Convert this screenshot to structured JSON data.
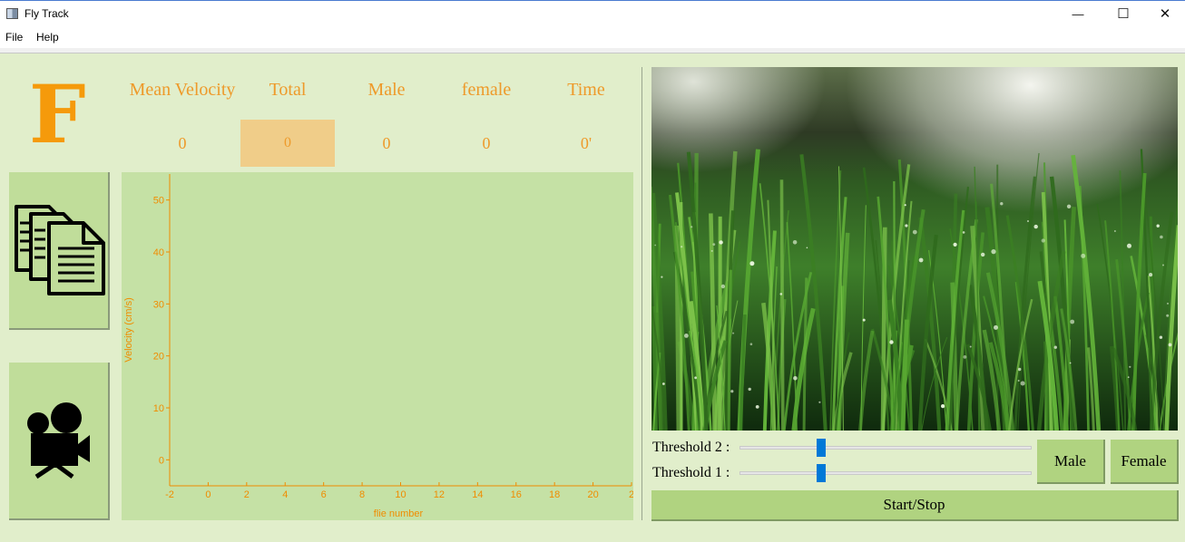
{
  "window": {
    "title": "Fly Track",
    "minimize": "—",
    "maximize": "☐",
    "close": "✕"
  },
  "menu": {
    "file": "File",
    "help": "Help"
  },
  "logo": {
    "letter": "F"
  },
  "stats": {
    "labels": {
      "mean_velocity": "Mean Velocity",
      "total": "Total",
      "male": "Male",
      "female": "female",
      "time": "Time"
    },
    "values": {
      "mean_velocity": "0",
      "total": "0",
      "male": "0",
      "female": "0",
      "time": "0'"
    }
  },
  "side_buttons": {
    "files_icon": "documents-icon",
    "camera_icon": "video-camera-icon"
  },
  "chart_data": {
    "type": "line",
    "xlabel": "flie number",
    "ylabel": "Velocity (cm/s)",
    "xlim": [
      -2,
      22
    ],
    "ylim": [
      -5,
      55
    ],
    "x_ticks": [
      "-2",
      "0",
      "2",
      "4",
      "6",
      "8",
      "10",
      "12",
      "14",
      "16",
      "18",
      "20",
      "2"
    ],
    "y_ticks": [
      "0",
      "10",
      "20",
      "30",
      "40",
      "50"
    ],
    "series": []
  },
  "controls": {
    "threshold2_label": "Threshold 2 :",
    "threshold1_label": "Threshold 1 :",
    "threshold2_value": 0.27,
    "threshold1_value": 0.27,
    "male_button": "Male",
    "female_button": "Female",
    "start_stop_button": "Start/Stop"
  },
  "colors": {
    "accent": "#f59a0b",
    "chart_axis": "#f08c00",
    "panel_bg": "#e1eecb",
    "chart_bg": "#c5e1a5",
    "slider": "#0078d7"
  }
}
